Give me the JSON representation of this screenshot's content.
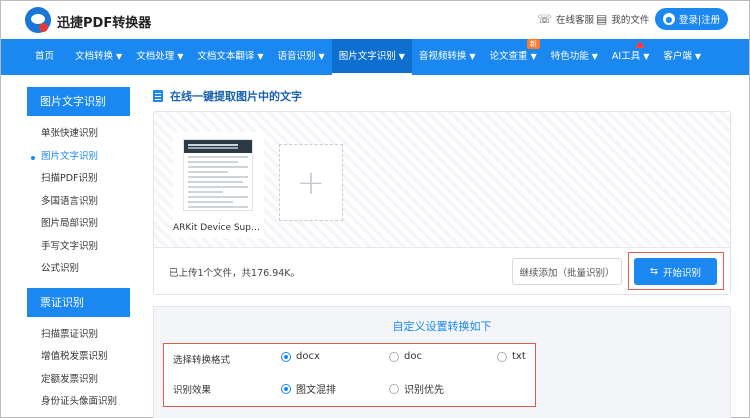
{
  "header": {
    "brand": "迅捷PDF转换器",
    "service_link": "在线客服",
    "files_link": "我的文件",
    "login_label": "登录|注册"
  },
  "nav": {
    "items": [
      {
        "label": "首页",
        "caret": ""
      },
      {
        "label": "文档转换",
        "caret": "▼"
      },
      {
        "label": "文档处理",
        "caret": "▼"
      },
      {
        "label": "文档文本翻译",
        "caret": "▼"
      },
      {
        "label": "语音识别",
        "caret": "▼"
      },
      {
        "label": "图片文字识别",
        "caret": "▼"
      },
      {
        "label": "音视频转换",
        "caret": "▼"
      },
      {
        "label": "论文查重",
        "caret": "▼"
      },
      {
        "label": "特色功能",
        "caret": "▼"
      },
      {
        "label": "AI工具",
        "caret": "▼"
      },
      {
        "label": "客户端",
        "caret": "▼"
      }
    ],
    "active_index": 5,
    "new_badge": "新"
  },
  "sidebar": {
    "section1_title": "图片文字识别",
    "section1_items": [
      "单张快速识别",
      "图片文字识别",
      "扫描PDF识别",
      "多国语言识别",
      "图片局部识别",
      "手写文字识别",
      "公式识别"
    ],
    "section2_title": "票证识别",
    "section2_items": [
      "扫描票证识别",
      "增值税发票识别",
      "定额发票识别",
      "身份证头像面识别"
    ]
  },
  "main": {
    "title": "在线一键提取图片中的文字",
    "file_name": "ARKit Device Supporting...",
    "upload_status": "已上传1个文件，共176.94K。",
    "batch_button": "继续添加（批量识别）",
    "start_button": "开始识别",
    "settings_title": "自定义设置转换如下",
    "format_label": "选择转换格式",
    "format_options": [
      "docx",
      "doc",
      "txt"
    ],
    "format_selected": "docx",
    "effect_label": "识别效果",
    "effect_options": [
      "图文混排",
      "识别优先"
    ],
    "effect_selected": "图文混排"
  },
  "colors": {
    "primary": "#1a88f0",
    "highlight_frame": "#e05a4e",
    "nav_active": "#0f6fd0"
  }
}
